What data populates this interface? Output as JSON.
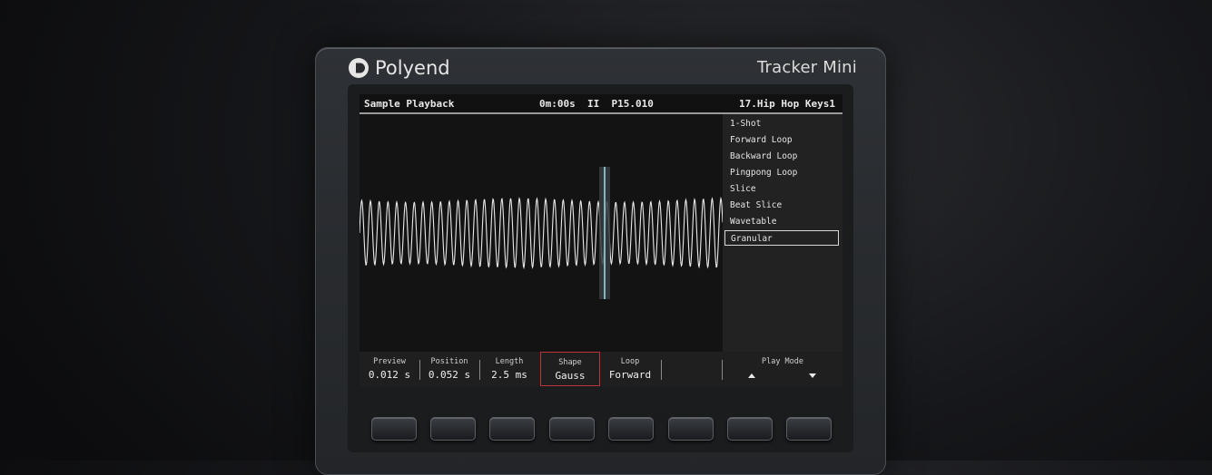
{
  "device": {
    "brand": "Polyend",
    "model": "Tracker Mini"
  },
  "screen": {
    "header": {
      "mode": "Sample Playback",
      "time_status": "0m:00s  II  P15.010",
      "instrument": "17.Hip Hop Keys1"
    },
    "play_modes": [
      {
        "label": "1-Shot"
      },
      {
        "label": "Forward Loop"
      },
      {
        "label": "Backward Loop"
      },
      {
        "label": "Pingpong Loop"
      },
      {
        "label": "Slice"
      },
      {
        "label": "Beat Slice"
      },
      {
        "label": "Wavetable"
      },
      {
        "label": "Granular"
      }
    ],
    "selected_play_mode": "Granular",
    "params": [
      {
        "label": "Preview",
        "value": "0.012 s"
      },
      {
        "label": "Position",
        "value": "0.052 s"
      },
      {
        "label": "Length",
        "value": "2.5 ms"
      },
      {
        "label": "Shape",
        "value": "Gauss"
      },
      {
        "label": "Loop",
        "value": "Forward"
      }
    ],
    "active_param": "Shape",
    "play_mode_param": {
      "label": "Play Mode",
      "prev_icon": "triangle-up-icon",
      "next_icon": "triangle-down-icon"
    }
  },
  "colors": {
    "active_border": "#c0333a",
    "grain_marker": "#7fb8c4"
  },
  "hardware_buttons": 8
}
